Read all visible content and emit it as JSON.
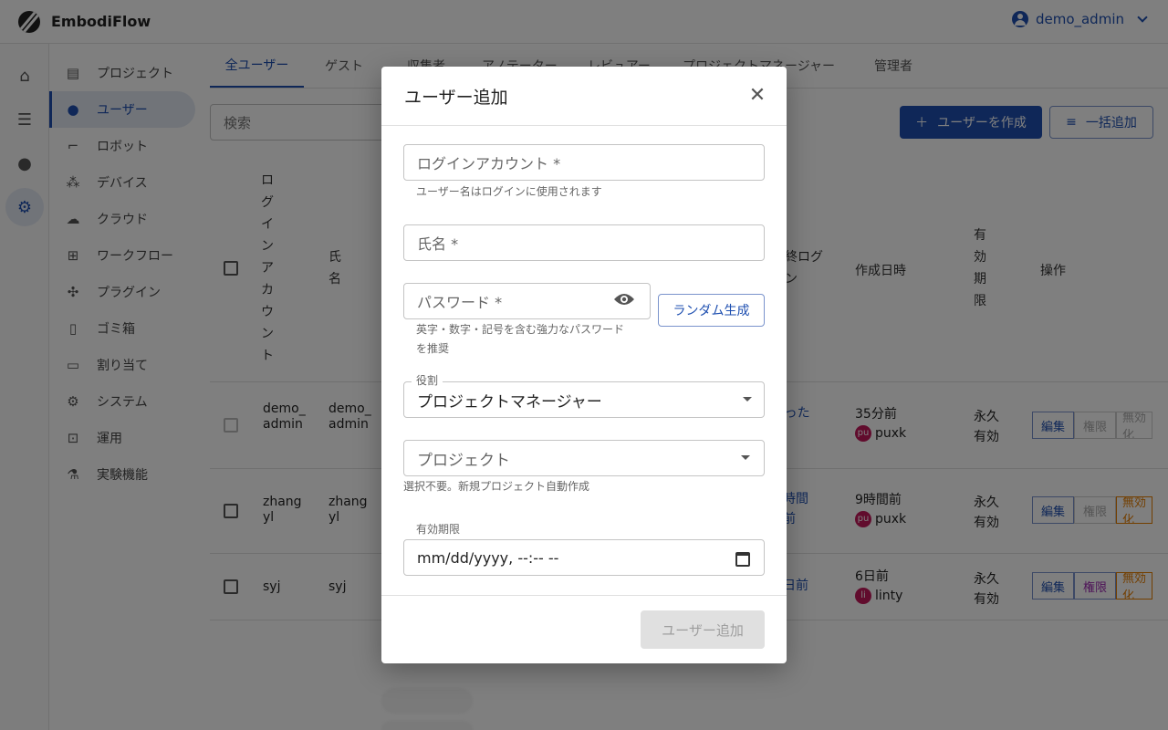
{
  "app": {
    "brand": "EmbodiFlow",
    "user": "demo_admin"
  },
  "rail": {
    "icons": [
      "home-icon",
      "storage-icon",
      "model-icon",
      "settings-icon"
    ]
  },
  "sidebar": {
    "items": [
      {
        "label": "プロジェクト",
        "icon": "project-icon"
      },
      {
        "label": "ユーザー",
        "icon": "users-icon"
      },
      {
        "label": "ロボット",
        "icon": "robot-icon"
      },
      {
        "label": "デバイス",
        "icon": "device-icon"
      },
      {
        "label": "クラウド",
        "icon": "cloud-icon"
      },
      {
        "label": "ワークフロー",
        "icon": "workflow-icon"
      },
      {
        "label": "プラグイン",
        "icon": "plugin-icon"
      },
      {
        "label": "ゴミ箱",
        "icon": "trash-icon"
      },
      {
        "label": "割り当て",
        "icon": "card-icon"
      },
      {
        "label": "システム",
        "icon": "gear-icon"
      },
      {
        "label": "運用",
        "icon": "monitor-icon"
      },
      {
        "label": "実験機能",
        "icon": "flask-icon"
      }
    ]
  },
  "tabs": [
    "全ユーザー",
    "ゲスト",
    "収集者",
    "アノテーター",
    "レビュアー",
    "プロジェクトマネージャー",
    "管理者"
  ],
  "toolbar": {
    "search_placeholder": "検索",
    "create_label": "ユーザーを作成",
    "bulk_label": "一括追加"
  },
  "table": {
    "headers": {
      "login": "ログインアカウント",
      "name": "氏名",
      "last_login": "最終ログイン",
      "created": "作成日時",
      "expiry": "有効期限",
      "actions": "操作"
    },
    "rows": [
      {
        "login": "demo_admin",
        "name": "demo_admin",
        "last": "とった今",
        "created": "35分前",
        "creator_initials": "pu",
        "creator": "puxk",
        "expiry": "永久有効",
        "edit": "編集",
        "perm": "権限",
        "disable": "無効化"
      },
      {
        "login": "zhangyl",
        "name": "zhangyl",
        "last": "時間前",
        "created": "9時間前",
        "creator_initials": "pu",
        "creator": "puxk",
        "expiry": "永久有効",
        "edit": "編集",
        "perm": "権限",
        "disable": "無効化"
      },
      {
        "login": "syj",
        "name": "syj",
        "last": "日前",
        "created": "6日前",
        "creator_initials": "li",
        "creator": "linty",
        "expiry": "永久有効",
        "edit": "編集",
        "perm": "権限",
        "disable": "無効化"
      }
    ]
  },
  "dialog": {
    "title": "ユーザー追加",
    "login_label": "ログインアカウント *",
    "login_helper": "ユーザー名はログインに使用されます",
    "name_label": "氏名 *",
    "password_label": "パスワード *",
    "password_helper_1": "英字・数字・記号を含む強力なパスワード",
    "password_helper_2": "を推奨",
    "random_label": "ランダム生成",
    "role_label": "役割",
    "role_value": "プロジェクトマネージャー",
    "project_placeholder": "プロジェクト",
    "project_helper": "選択不要。新規プロジェクト自動作成",
    "expiry_label": "有効期限",
    "expiry_placeholder": "mm/dd/yyyy, --:-- --",
    "submit_label": "ユーザー追加"
  }
}
